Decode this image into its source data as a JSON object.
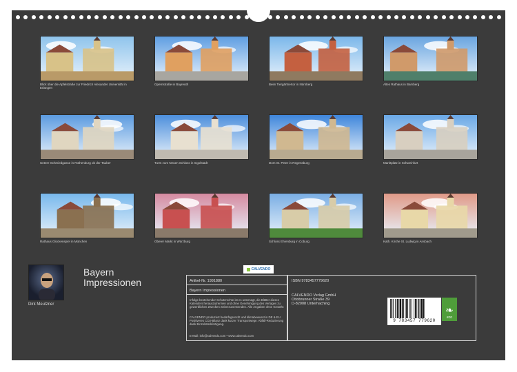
{
  "calendar": {
    "title_line1": "Bayern",
    "title_line2": "Impressionen",
    "author": "Dirk Meutzner"
  },
  "photos": [
    {
      "caption": "Blick über die Apfelstraße zur Friedrich Alexander Universität in Erlangen",
      "sky": "#8fc4ec",
      "ground": "#b99a68",
      "accent": "#d8c288"
    },
    {
      "caption": "Opernstraße in Bayreuth",
      "sky": "#5f9ee2",
      "ground": "#a8a6a0",
      "accent": "#e0a060"
    },
    {
      "caption": "Beim Tiergärtnertor in Nürnberg",
      "sky": "#7bb7ea",
      "ground": "#8f7a60",
      "accent": "#c46040"
    },
    {
      "caption": "Altes Rathaus in Bamberg",
      "sky": "#6aa5e0",
      "ground": "#4f7f6a",
      "accent": "#d09a6a"
    },
    {
      "caption": "Untere Schmiedgasse in Rothenburg ob der Tauber",
      "sky": "#5c9be0",
      "ground": "#9a8a78",
      "accent": "#e0d6c0"
    },
    {
      "caption": "Turm zum Neuen Schloss in Ingolstadt",
      "sky": "#4d8fdc",
      "ground": "#c0bab0",
      "accent": "#e8e0d0"
    },
    {
      "caption": "Dom St. Peter in Regensburg",
      "sky": "#3f86db",
      "ground": "#b8aa90",
      "accent": "#d0b890"
    },
    {
      "caption": "Marktplatz in Schweinfurt",
      "sky": "#6aa8e6",
      "ground": "#a8a49c",
      "accent": "#d8cfc0"
    },
    {
      "caption": "Rathaus Glockenspiel in München",
      "sky": "#78b8ec",
      "ground": "#9a8a70",
      "accent": "#8a7050"
    },
    {
      "caption": "Oberer Markt in Würzburg",
      "sky": "#d58aa0",
      "ground": "#8a7a6a",
      "accent": "#c85050"
    },
    {
      "caption": "Schloss Ehrenburg in Coburg",
      "sky": "#7aaee4",
      "ground": "#4f8a3c",
      "accent": "#d8cca8"
    },
    {
      "caption": "Kath. Kirche St. Ludwig in Ansbach",
      "sky": "#e09a88",
      "ground": "#a09a8c",
      "accent": "#e8d8a8"
    }
  ],
  "info": {
    "article_label": "Artikel-Nr. 1991880",
    "logo_text": "CALVENDO",
    "calendar_title": "Bayern Impressionen",
    "isbn": "ISBN 9783457779620",
    "publisher_line1": "CALVENDO Verlag GmbH",
    "publisher_line2": "Ottobrunner Straße 39",
    "publisher_line3": "D-82008 Unterhaching",
    "legal1": "Infolge bestehender Schutzrechte ist es untersagt, die Blätter dieses Kalenders herauszutrennen und ohne Genehmigung des Verlages zu gewerblichen Zwecken weiterzuverwenden. Alle Angaben ohne Gewähr.",
    "legal2": "CALVENDO produziert bedarfsgerecht und klimabewusst in DE & EU. Positiveres CO2-Bilanz dank kurzer Transportwege. Abfall-Reduzierung dank Einzelstückfertigung.",
    "contact": "E-Mail: info@calvendo.com • www.calvendo.com",
    "barcode_number": "9 783457 779620",
    "eco_label": "eco"
  }
}
